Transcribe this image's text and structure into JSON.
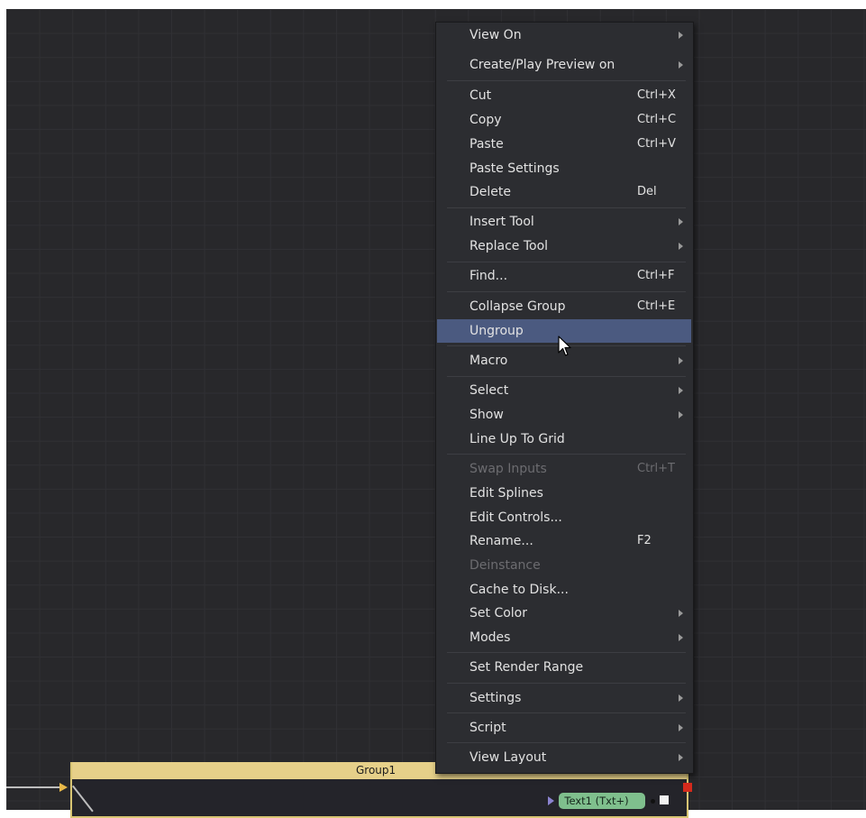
{
  "group": {
    "title": "Group1",
    "icon": "group-view-icon",
    "icon_text": "↗≡"
  },
  "node": {
    "label": "Text1  (Txt+)"
  },
  "colors": {
    "canvas_bg": "#28282b",
    "menu_bg": "#2c2d31",
    "highlight": "#4b5a80",
    "group_header": "#e6d089",
    "node_green": "#7fbf8d"
  },
  "menu": {
    "items": [
      {
        "label": "View On",
        "submenu": true
      },
      {
        "label": "Create/Play Preview on",
        "submenu": true
      },
      {
        "label": "Cut",
        "shortcut": "Ctrl+X"
      },
      {
        "label": "Copy",
        "shortcut": "Ctrl+C"
      },
      {
        "label": "Paste",
        "shortcut": "Ctrl+V"
      },
      {
        "label": "Paste Settings"
      },
      {
        "label": "Delete",
        "shortcut": "Del"
      },
      {
        "label": "Insert Tool",
        "submenu": true
      },
      {
        "label": "Replace Tool",
        "submenu": true
      },
      {
        "label": "Find...",
        "shortcut": "Ctrl+F"
      },
      {
        "label": "Collapse Group",
        "shortcut": "Ctrl+E"
      },
      {
        "label": "Ungroup",
        "highlighted": true
      },
      {
        "label": "Macro",
        "submenu": true
      },
      {
        "label": "Select",
        "submenu": true
      },
      {
        "label": "Show",
        "submenu": true
      },
      {
        "label": "Line Up To Grid"
      },
      {
        "label": "Swap Inputs",
        "shortcut": "Ctrl+T",
        "disabled": true
      },
      {
        "label": "Edit Splines"
      },
      {
        "label": "Edit Controls..."
      },
      {
        "label": "Rename...",
        "shortcut": "F2"
      },
      {
        "label": "Deinstance",
        "disabled": true
      },
      {
        "label": "Cache to Disk..."
      },
      {
        "label": "Set Color",
        "submenu": true
      },
      {
        "label": "Modes",
        "submenu": true
      },
      {
        "label": "Set Render Range"
      },
      {
        "label": "Settings",
        "submenu": true
      },
      {
        "label": "Script",
        "submenu": true
      },
      {
        "label": "View Layout",
        "submenu": true
      }
    ]
  }
}
